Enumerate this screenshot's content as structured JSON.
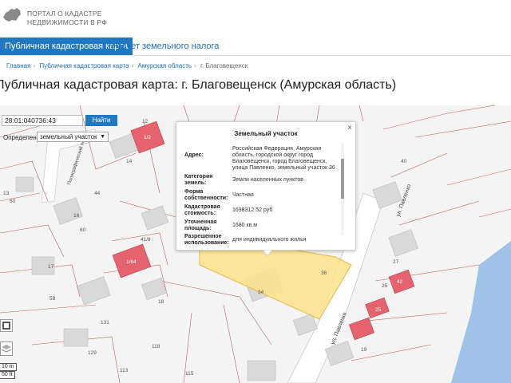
{
  "header": {
    "logo_line1": "ПОРТАЛ О КАДАСТРЕ",
    "logo_line2": "НЕДВИЖИМОСТИ В РФ"
  },
  "nav": {
    "tab_active": "Публичная кадастровая карта",
    "tab_tax": "Расчет земельного налога"
  },
  "breadcrumbs": [
    "Главная",
    "Публичная кадастровая карта",
    "Амурская область",
    "г. Благовещенск"
  ],
  "page_title": "Публичная кадастровая карта: г. Благовещенск (Амурская область)",
  "search": {
    "value": "28:01:040736:43",
    "button": "Найти"
  },
  "definition": {
    "label": "Определение:",
    "selected": "земельный участок"
  },
  "popup": {
    "title": "Земельный участок",
    "close": "×",
    "rows": [
      {
        "key": "Адрес:",
        "value": "Российская Федерация, Амурская область, городской округ город Благовещенск, город Благовещенск, улица Павленко, земельный участок 36"
      },
      {
        "key": "Категория земель:",
        "value": "Земли населенных пунктов"
      },
      {
        "key": "Форма собственности:",
        "value": "Частная"
      },
      {
        "key": "Кадастровая стоимость:",
        "value": "1698312.52 руб"
      },
      {
        "key": "Уточненная площадь:",
        "value": "1680 кв.м"
      },
      {
        "key": "Разрешенное использование:",
        "value": "для индивидуального жилья"
      }
    ]
  },
  "map": {
    "street_pavlenko": "ул. Павленко",
    "street_lanes": "Полиграфический пер.",
    "parcel_numbers": [
      "12",
      "14",
      "13",
      "16",
      "41/8",
      "17",
      "18",
      "34",
      "36",
      "40",
      "27",
      "25",
      "19",
      "44",
      "60",
      "58",
      "50",
      "129",
      "113",
      "118",
      "115",
      "131"
    ],
    "red_labels": [
      "1/2",
      "1/64",
      "42",
      "25"
    ],
    "scale_1": "10 m",
    "scale_2": "50 ft"
  }
}
